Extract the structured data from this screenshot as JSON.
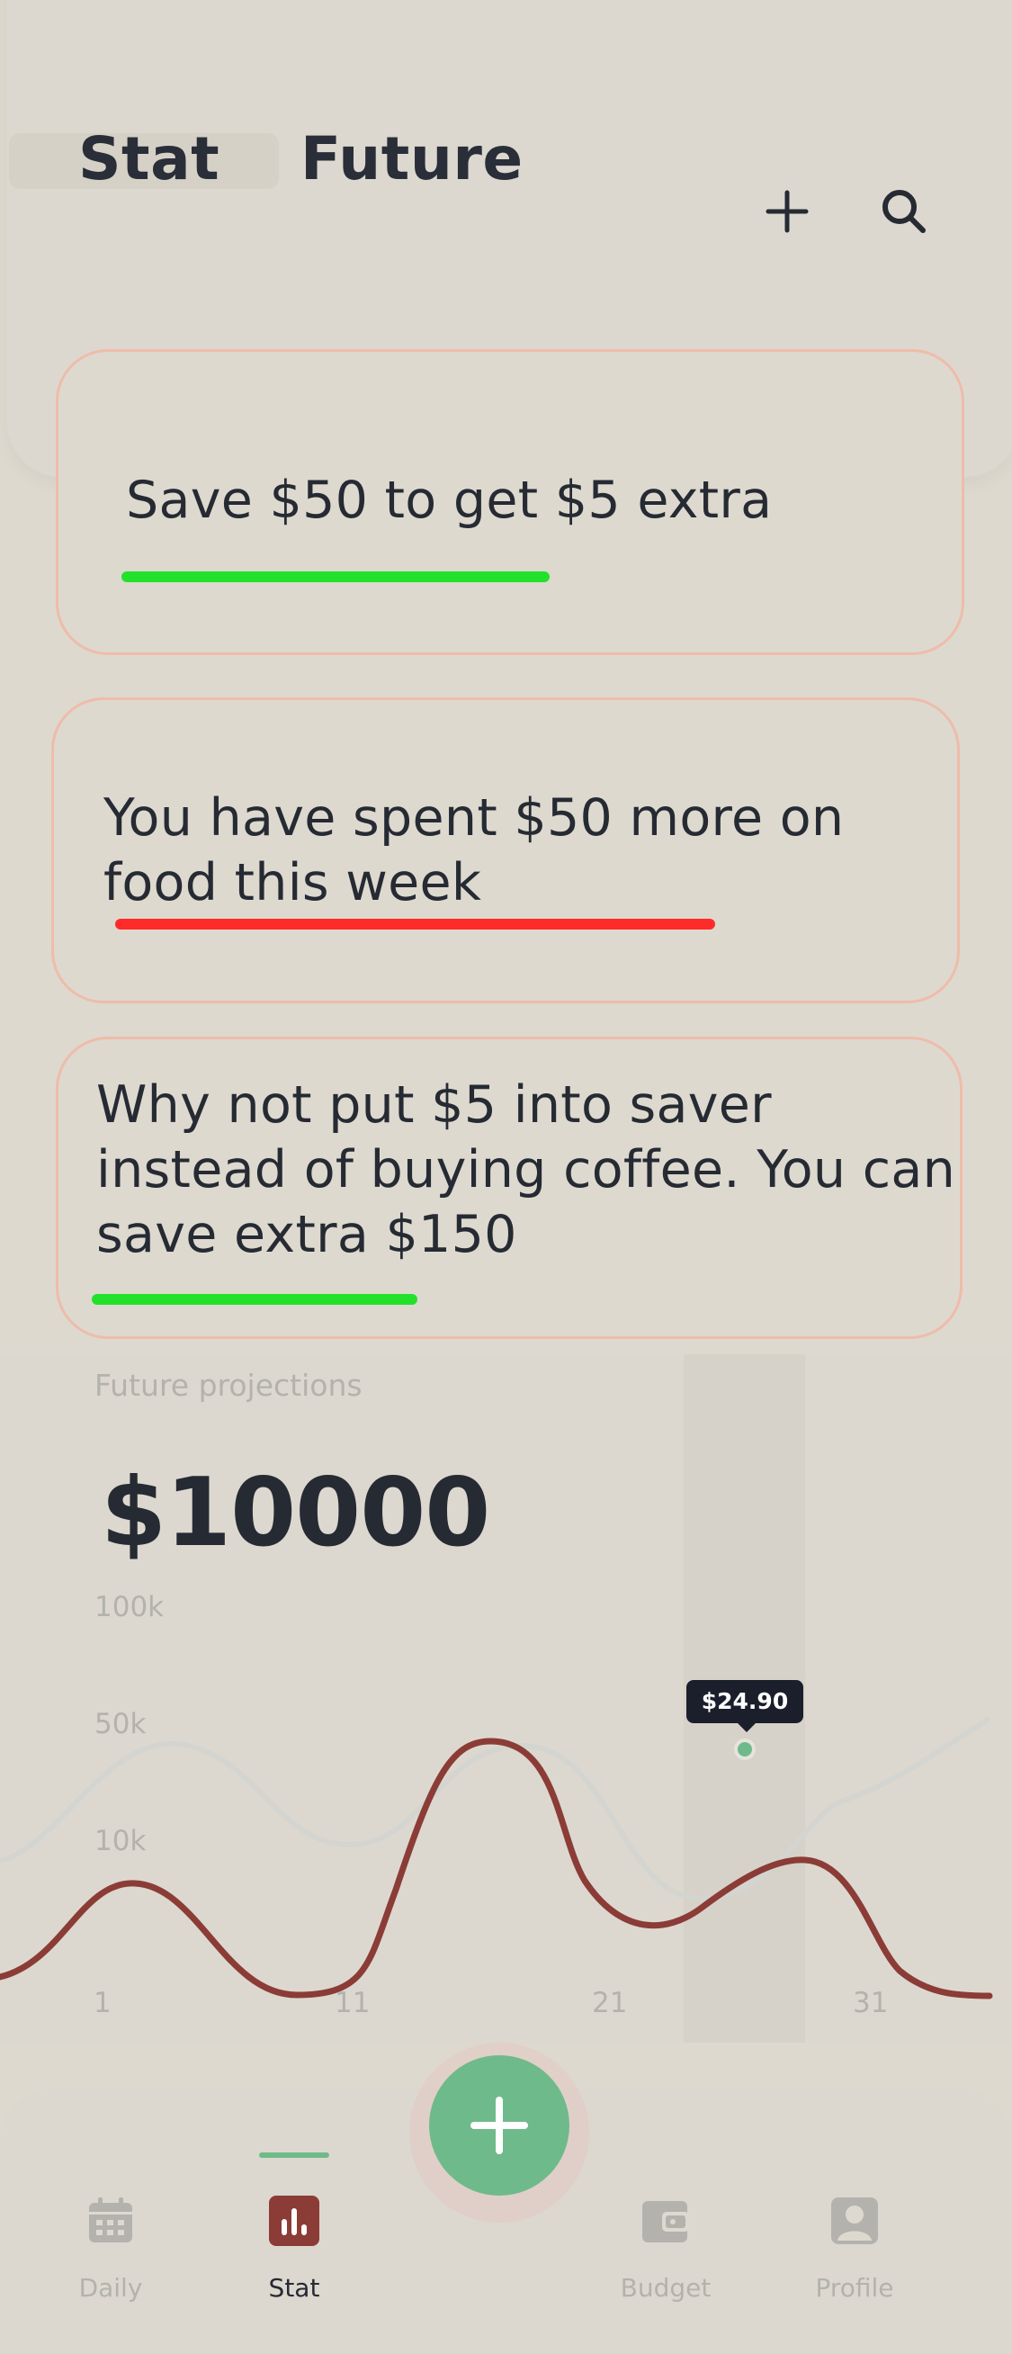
{
  "header": {
    "tabs": [
      {
        "label": "Stat",
        "active": true
      },
      {
        "label": "Future",
        "active": false
      }
    ],
    "add_icon": "plus-icon",
    "search_icon": "search-icon"
  },
  "insights": [
    {
      "text": "Save $50 to get $5 extra",
      "bar_color": "#22e12a"
    },
    {
      "text": "You have spent $50 more on food this week",
      "bar_color": "#ff2a2a"
    },
    {
      "text": "Why not put $5 into saver instead of buying coffee. You can save extra $150",
      "bar_color": "#22e12a"
    }
  ],
  "projection": {
    "label": "Future projections",
    "value": "$10000",
    "y_ticks": [
      "100k",
      "50k",
      "10k"
    ],
    "x_ticks": [
      "1",
      "11",
      "21",
      "31"
    ],
    "tooltip": "$24.90"
  },
  "nav": {
    "items": [
      {
        "label": "Daily",
        "icon": "calendar-icon",
        "active": false
      },
      {
        "label": "Stat",
        "icon": "bar-chart-icon",
        "active": true
      },
      {
        "label": "Budget",
        "icon": "wallet-icon",
        "active": false
      },
      {
        "label": "Profile",
        "icon": "profile-icon",
        "active": false
      }
    ],
    "fab_icon": "plus-icon"
  },
  "colors": {
    "accent_green": "#6fba8a",
    "line_red": "#8b3c36",
    "text_dark": "#262a33",
    "muted": "#b3b2ad"
  }
}
